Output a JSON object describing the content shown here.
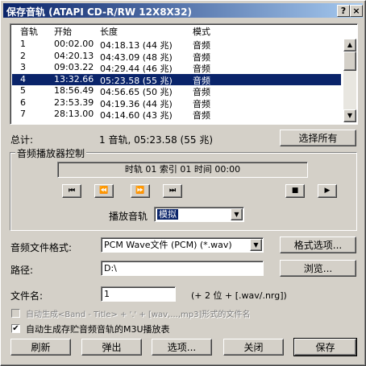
{
  "window": {
    "title": "保存音轨 (ATAPI   CD-R/RW 12X8X32)",
    "help_btn": "?",
    "close_btn": "×"
  },
  "tracklist": {
    "headers": [
      "音轨",
      "开始",
      "长度",
      "模式"
    ],
    "rows": [
      {
        "track": "1",
        "start": "00:02.00",
        "length": "04:18.13 (44 兆)",
        "mode": "音频"
      },
      {
        "track": "2",
        "start": "04:20.13",
        "length": "04:43.09 (48 兆)",
        "mode": "音频"
      },
      {
        "track": "3",
        "start": "09:03.22",
        "length": "04:29.44 (46 兆)",
        "mode": "音频"
      },
      {
        "track": "4",
        "start": "13:32.66",
        "length": "05:23.58 (55 兆)",
        "mode": "音频",
        "selected": true
      },
      {
        "track": "5",
        "start": "18:56.49",
        "length": "04:56.65 (50 兆)",
        "mode": "音频"
      },
      {
        "track": "6",
        "start": "23:53.39",
        "length": "04:19.36 (44 兆)",
        "mode": "音频"
      },
      {
        "track": "7",
        "start": "28:13.00",
        "length": "04:14.60 (43 兆)",
        "mode": "音频"
      }
    ]
  },
  "total": {
    "label": "总计:",
    "value": "1 音轨, 05:23.58 (55 兆)",
    "select_all": "选择所有"
  },
  "player": {
    "group_title": "音频播放器控制",
    "display": "时轨 01 索引 01 时间 00:00",
    "buttons": {
      "prev": "⏮",
      "rew": "⏪",
      "ff": "⏩",
      "next": "⏭",
      "stop": "■",
      "play": "▶"
    },
    "play_track_label": "播放音轨",
    "play_track_value": "模拟"
  },
  "format": {
    "label": "音频文件格式:",
    "value": "PCM Wave文件 (PCM) (*.wav)",
    "options_btn": "格式选项..."
  },
  "path": {
    "label": "路径:",
    "value": "D:\\",
    "browse_btn": "浏览..."
  },
  "filename": {
    "label": "文件名:",
    "value": "1",
    "suffix": "(+ 2 位 + [.wav/.nrg])"
  },
  "options": {
    "auto_name": {
      "checked": false,
      "disabled": true,
      "label": "自动生成<Band - Title> + '.' + [wav,...,mp3]形式的文件名"
    },
    "m3u": {
      "checked": true,
      "label": "自动生成存贮音频音轨的M3U播放表"
    }
  },
  "bottom_buttons": {
    "refresh": "刷新",
    "eject": "弹出",
    "options": "选项...",
    "close": "关闭",
    "save": "保存"
  }
}
